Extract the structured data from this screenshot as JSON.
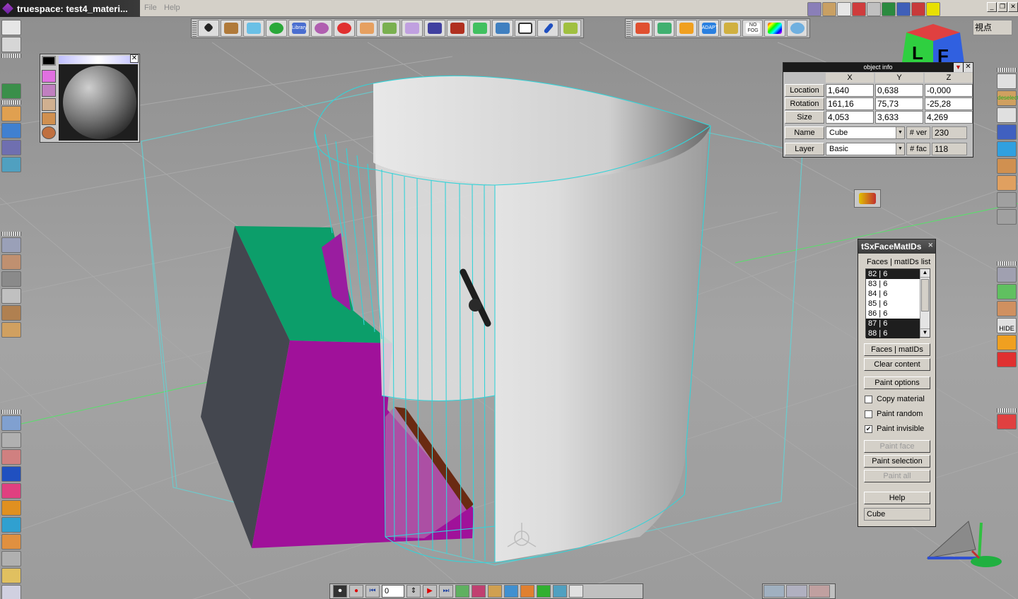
{
  "window": {
    "title": "truespace: test4_materi...",
    "menu": [
      "File",
      "Help"
    ],
    "controls": [
      "_",
      "❐",
      "✕"
    ]
  },
  "colors": {
    "cyan_wire": "#3ad7dc",
    "green_face": "#0c9e6a",
    "magenta_face": "#a0119a",
    "dark_face": "#44474f",
    "brown_face": "#6a2a12",
    "cylinder": "#dcdcdc"
  },
  "object_info": {
    "title": "object info",
    "headers": [
      "X",
      "Y",
      "Z"
    ],
    "rows": [
      {
        "label": "Location",
        "x": "1,640",
        "y": "0,638",
        "z": "-0,000"
      },
      {
        "label": "Rotation",
        "x": "161,16",
        "y": "75,73",
        "z": "-25,28"
      },
      {
        "label": "Size",
        "x": "4,053",
        "y": "3,633",
        "z": "4,269"
      }
    ],
    "name_label": "Name",
    "name_value": "Cube",
    "layer_label": "Layer",
    "layer_value": "Basic",
    "ver_label": "# ver",
    "ver_value": "230",
    "fac_label": "# fac",
    "fac_value": "118"
  },
  "face_panel": {
    "title": "tSxFaceMatIDs",
    "list_label": "Faces | matIDs list",
    "items": [
      {
        "text": "82 | 6",
        "selected": true
      },
      {
        "text": "83 | 6",
        "selected": false
      },
      {
        "text": "84 | 6",
        "selected": false
      },
      {
        "text": "85 | 6",
        "selected": false
      },
      {
        "text": "86 | 6",
        "selected": false
      },
      {
        "text": "87 | 6",
        "selected": true
      },
      {
        "text": "88 | 6",
        "selected": true
      }
    ],
    "btn_faces": "Faces | matIDs",
    "btn_clear": "Clear content",
    "btn_paint_options": "Paint options",
    "copy_material": "Copy material",
    "paint_random": "Paint random",
    "paint_invisible": "Paint invisible",
    "copy_material_checked": false,
    "paint_random_checked": false,
    "paint_invisible_checked": true,
    "btn_paint_face": "Paint face",
    "btn_paint_selection": "Paint selection",
    "btn_paint_all": "Paint all",
    "btn_help": "Help",
    "status": "Cube"
  },
  "animation": {
    "frame": "0"
  },
  "right_toolbar": {
    "deselect_label": "deselect",
    "hide_label": "HIDE"
  },
  "top_toolbar": {
    "library_label": "Library",
    "no_fog_label": "NO FOG",
    "adapt_label": "ADAPT",
    "viewpoint_label": "視点"
  },
  "viewcube": {
    "left": "L",
    "front": "F"
  }
}
